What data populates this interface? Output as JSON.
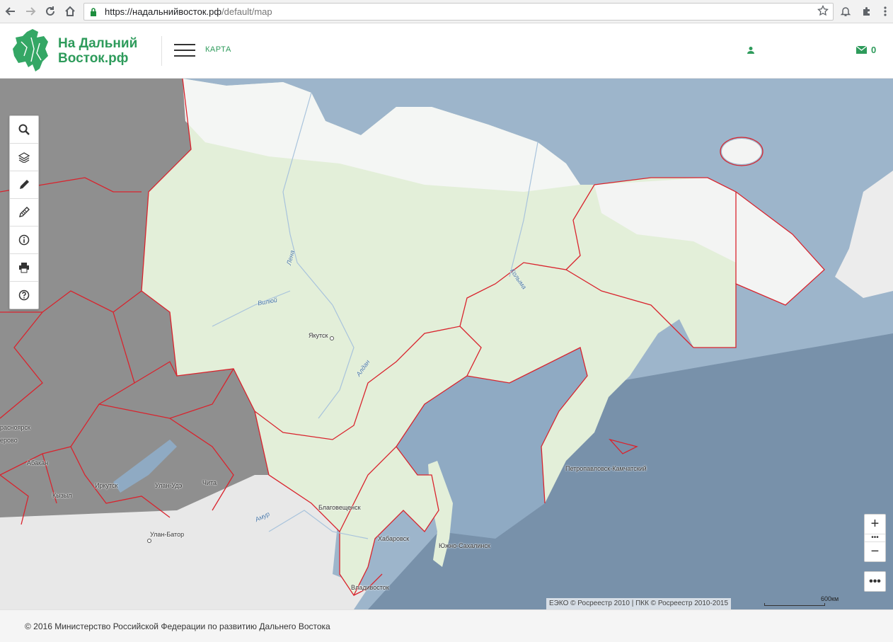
{
  "browser": {
    "url_host": "https://надальнийвосток.рф",
    "url_path": "/default/map"
  },
  "header": {
    "logo_line1": "На Дальний",
    "logo_line2": "Восток.рф",
    "nav_map": "КАРТА",
    "mail_count": "0",
    "brand_color": "#2e9b5b"
  },
  "tools": {
    "items": [
      "search-icon",
      "layers-icon",
      "pencil-icon",
      "edit-ruler-icon",
      "info-icon",
      "print-icon",
      "help-icon"
    ]
  },
  "map": {
    "places": {
      "yakutsk": "Якутск",
      "krasnoyarsk": "расноярск",
      "kemerovo": "ерово",
      "abakan": "Абакан",
      "kyzyl": "Кызыл",
      "irkutsk": "Иркутск",
      "ulan_ude": "Улан-Удэ",
      "chita": "Чита",
      "ulan_bator": "Улан-Батор",
      "blagoveshchensk": "Благовещенск",
      "khabarovsk": "Хабаровск",
      "yuzhno": "Южно-Сахалинск",
      "vladivostok": "Владивосток",
      "petropavlovsk": "Петропавловск-Камчатский"
    },
    "rivers": {
      "lena": "Лена",
      "vilyuy": "Вилюй",
      "aldan": "Алдан",
      "kolyma": "Колыма",
      "amur": "Амур"
    },
    "zoom_in": "+",
    "zoom_mid": "•••",
    "zoom_out": "−",
    "more": "•••",
    "attribution": "ЕЭКО © Росреестр 2010 | ПКК © Росреестр 2010-2015",
    "scale_label": "600км"
  },
  "footer": {
    "text": "© 2016 Министерство Российской Федерации по развитию Дальнего Востока"
  }
}
